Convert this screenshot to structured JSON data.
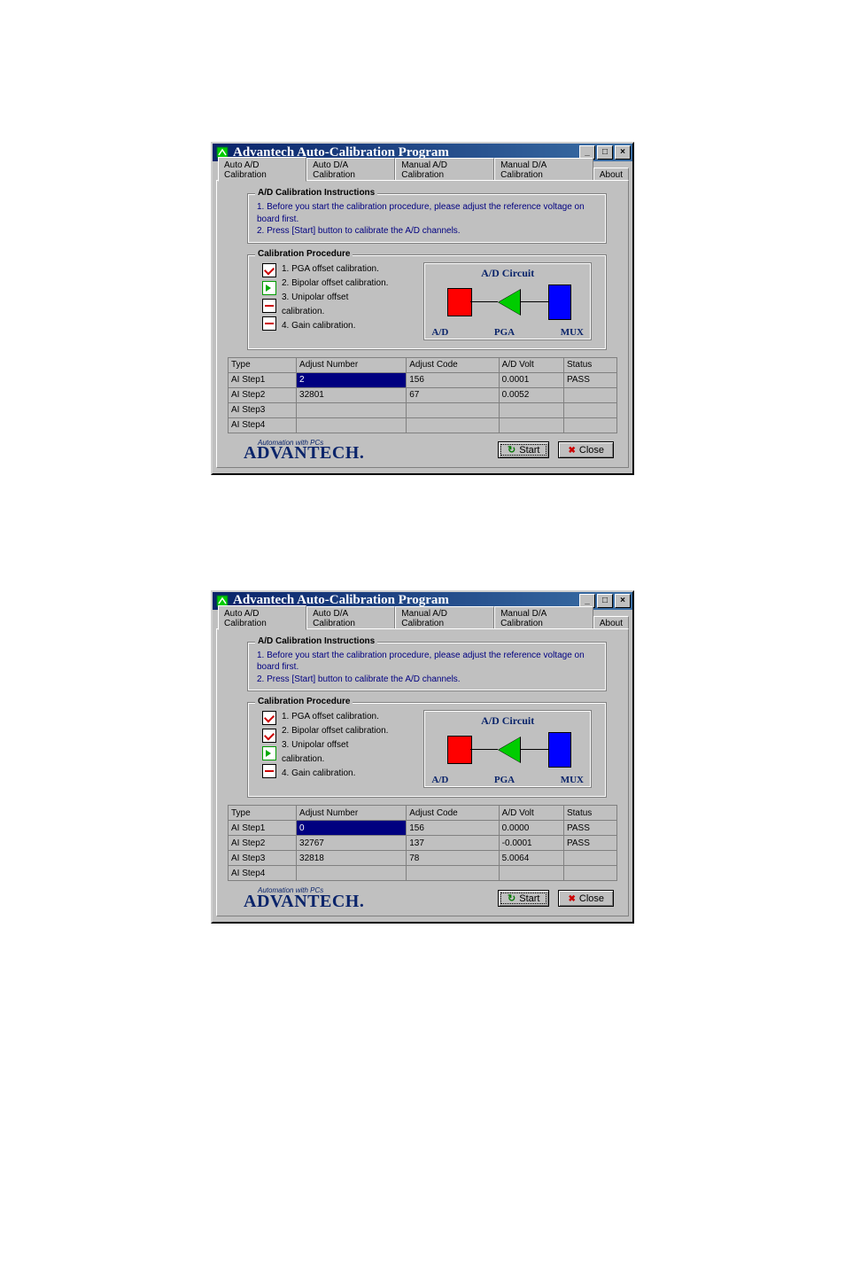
{
  "shared": {
    "title": "Advantech Auto-Calibration Program",
    "tabs": [
      "Auto A/D Calibration",
      "Auto D/A Calibration",
      "Manual A/D Calibration",
      "Manual D/A Calibration",
      "About"
    ],
    "instructions_title": "A/D Calibration Instructions",
    "instructions": [
      "1. Before you start the calibration procedure, please adjust the reference voltage on board first.",
      "2. Press [Start] button to calibrate the A/D channels."
    ],
    "procedure_title": "Calibration Procedure",
    "steps": [
      "1. PGA offset calibration.",
      "2. Bipolar offset calibration.",
      "3. Unipolar offset calibration.",
      "4. Gain calibration."
    ],
    "circuit_title": "A/D Circuit",
    "circuit_labels": {
      "ad": "A/D",
      "pga": "PGA",
      "mux": "MUX"
    },
    "columns": [
      "Type",
      "Adjust Number",
      "Adjust Code",
      "A/D Volt",
      "Status"
    ],
    "logo_tag": "Automation with PCs",
    "logo_main": "ADVANTECH.",
    "start_label": "Start",
    "close_label": "Close"
  },
  "window1": {
    "step_states": [
      "check",
      "arrow",
      "dash",
      "dash"
    ],
    "rows": [
      {
        "type": "AI Step1",
        "adjnum": "2",
        "adjcode": "156",
        "volt": "0.0001",
        "status": "PASS",
        "hl": true
      },
      {
        "type": "AI Step2",
        "adjnum": "32801",
        "adjcode": "67",
        "volt": "0.0052",
        "status": "",
        "hl": false
      },
      {
        "type": "AI Step3",
        "adjnum": "",
        "adjcode": "",
        "volt": "",
        "status": "",
        "hl": false
      },
      {
        "type": "AI Step4",
        "adjnum": "",
        "adjcode": "",
        "volt": "",
        "status": "",
        "hl": false
      }
    ]
  },
  "window2": {
    "step_states": [
      "check",
      "check",
      "arrow",
      "dash"
    ],
    "rows": [
      {
        "type": "AI Step1",
        "adjnum": "0",
        "adjcode": "156",
        "volt": "0.0000",
        "status": "PASS",
        "hl": true
      },
      {
        "type": "AI Step2",
        "adjnum": "32767",
        "adjcode": "137",
        "volt": "-0.0001",
        "status": "PASS",
        "hl": false
      },
      {
        "type": "AI Step3",
        "adjnum": "32818",
        "adjcode": "78",
        "volt": "5.0064",
        "status": "",
        "hl": false
      },
      {
        "type": "AI Step4",
        "adjnum": "",
        "adjcode": "",
        "volt": "",
        "status": "",
        "hl": false
      }
    ]
  }
}
